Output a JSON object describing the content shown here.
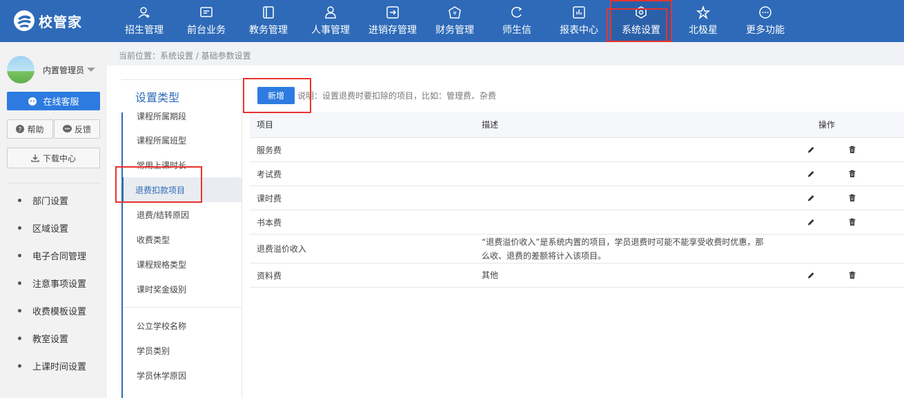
{
  "app": {
    "brand": "校管家"
  },
  "nav": [
    {
      "label": "招生管理",
      "icon": "user-add-icon"
    },
    {
      "label": "前台业务",
      "icon": "monitor-icon"
    },
    {
      "label": "教务管理",
      "icon": "book-icon"
    },
    {
      "label": "人事管理",
      "icon": "person-icon"
    },
    {
      "label": "进销存管理",
      "icon": "inventory-icon"
    },
    {
      "label": "财务管理",
      "icon": "finance-icon"
    },
    {
      "label": "师生信",
      "icon": "chat-icon"
    },
    {
      "label": "报表中心",
      "icon": "report-icon"
    },
    {
      "label": "系统设置",
      "icon": "settings-icon"
    },
    {
      "label": "北极星",
      "icon": "star-icon"
    },
    {
      "label": "更多功能",
      "icon": "more-icon"
    }
  ],
  "user": {
    "name": "内置管理员"
  },
  "sidebar": {
    "service": "在线客服",
    "help": "帮助",
    "feedback": "反馈",
    "download": "下载中心",
    "items": [
      "部门设置",
      "区域设置",
      "电子合同管理",
      "注意事项设置",
      "收费模板设置",
      "教室设置",
      "上课时间设置"
    ]
  },
  "breadcrumb": "当前位置：系统设置 / 基础参数设置",
  "settings": {
    "title": "设置类型",
    "group1": [
      "课程所属期段",
      "课程所属班型",
      "常用上课时长",
      "退费扣款项目",
      "退费/结转原因",
      "收费类型",
      "课程规格类型",
      "课时奖金级别"
    ],
    "group2": [
      "公立学校名称",
      "学员类别",
      "学员休学原因"
    ]
  },
  "toolbar": {
    "add": "新增",
    "note": "说明：设置退费时要扣除的项目，比如：管理费、杂费"
  },
  "table": {
    "headers": [
      "项目",
      "描述",
      "操作"
    ],
    "rows": [
      {
        "item": "服务费",
        "desc": "",
        "editable": true
      },
      {
        "item": "考试费",
        "desc": "",
        "editable": true
      },
      {
        "item": "课时费",
        "desc": "",
        "editable": true
      },
      {
        "item": "书本费",
        "desc": "",
        "editable": true
      },
      {
        "item": "退费溢价收入",
        "desc": "“退费溢价收入”是系统内置的项目，学员退费时可能不能享受收费时优惠，那么收、退费的差额将计入该项目。",
        "editable": false
      },
      {
        "item": "资料费",
        "desc": "其他",
        "editable": true
      }
    ]
  },
  "colors": {
    "primary": "#2e6ab8",
    "button": "#2d7be0",
    "highlight": "#e8322e"
  }
}
